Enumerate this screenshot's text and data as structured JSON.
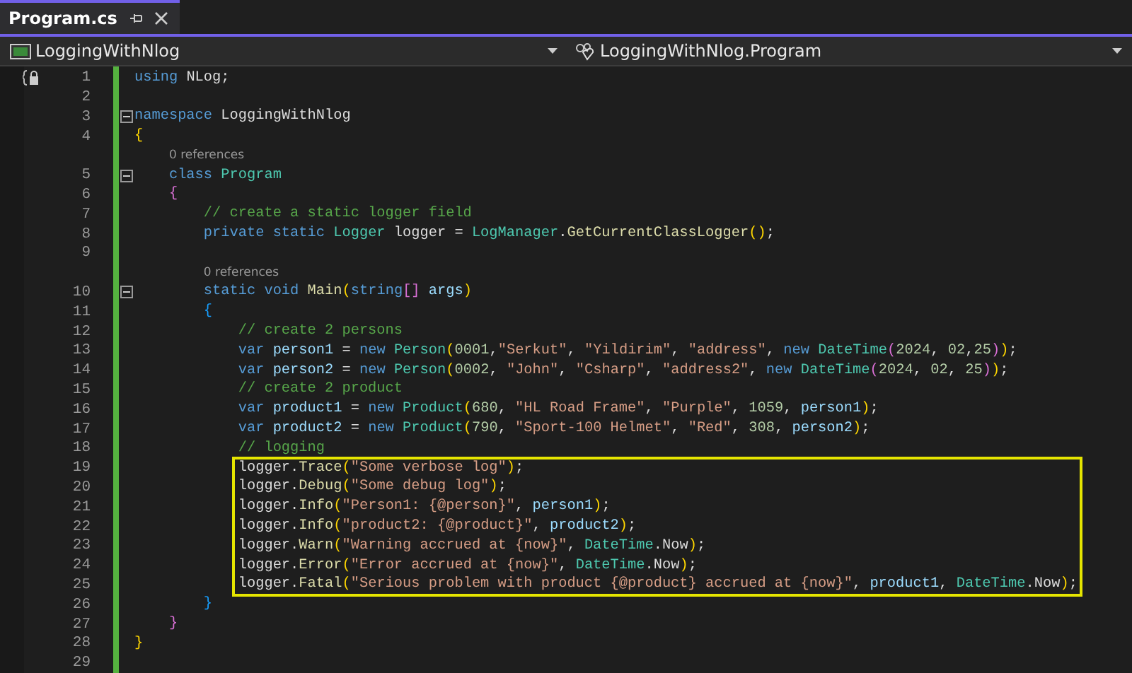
{
  "tab": {
    "title": "Program.cs",
    "selected": true
  },
  "nav": {
    "project": "LoggingWithNlog",
    "member": "LoggingWithNlog.Program"
  },
  "lines": [
    {
      "kind": "code",
      "number": "1",
      "highlighted": false,
      "tokens": [
        {
          "text": "using",
          "kind": "kw"
        },
        {
          "text": " NLog;",
          "kind": "txt"
        }
      ]
    },
    {
      "kind": "code",
      "number": "2",
      "highlighted": false
    },
    {
      "kind": "code",
      "number": "3",
      "highlighted": false,
      "fold": {
        "expanded": true
      },
      "tokens": [
        {
          "text": "namespace",
          "kind": "kw"
        },
        {
          "text": " LoggingWithNlog",
          "kind": "txt"
        }
      ]
    },
    {
      "kind": "code",
      "number": "4",
      "highlighted": false,
      "tokens": [
        {
          "text": "{",
          "kind": "open1"
        }
      ]
    },
    {
      "kind": "codelens",
      "text": "0 references"
    },
    {
      "kind": "code",
      "number": "5",
      "highlighted": false,
      "fold": {
        "expanded": true
      },
      "tokens": [
        {
          "text": "class ",
          "kind": "kw"
        },
        {
          "text": "Program",
          "kind": "type"
        }
      ]
    },
    {
      "kind": "code",
      "number": "6",
      "highlighted": false,
      "tokens": [
        {
          "text": "{",
          "kind": "open2"
        }
      ]
    },
    {
      "kind": "code",
      "number": "7",
      "highlighted": false,
      "tokens": [
        {
          "text": "// create a static logger field",
          "kind": "com"
        }
      ]
    },
    {
      "kind": "code",
      "number": "8",
      "highlighted": false,
      "tokens": [
        {
          "text": "private static ",
          "kind": "kw"
        },
        {
          "text": "Logger",
          "kind": "type"
        },
        {
          "text": " logger = ",
          "kind": "txt"
        },
        {
          "text": "LogManager",
          "kind": "type"
        },
        {
          "text": ".",
          "kind": "txt"
        },
        {
          "text": "GetCurrentClassLogger",
          "kind": "fn"
        },
        {
          "text": "()",
          "kind": "p1"
        },
        {
          "text": ";",
          "kind": "txt"
        }
      ]
    },
    {
      "kind": "code",
      "number": "9",
      "highlighted": false
    },
    {
      "kind": "codelens",
      "text": "0 references"
    },
    {
      "kind": "code",
      "number": "10",
      "highlighted": false,
      "fold": {
        "expanded": true
      },
      "tokens": [
        {
          "text": "static void ",
          "kind": "kw"
        },
        {
          "text": "Main",
          "kind": "fn"
        },
        {
          "text": "(",
          "kind": "p1"
        },
        {
          "text": "string",
          "kind": "kw"
        },
        {
          "text": "[]",
          "kind": "p2"
        },
        {
          "text": " args",
          "kind": "var"
        },
        {
          "text": ")",
          "kind": "p1"
        }
      ]
    },
    {
      "kind": "code",
      "number": "11",
      "highlighted": false,
      "tokens": [
        {
          "text": "{",
          "kind": "open3"
        }
      ]
    },
    {
      "kind": "code",
      "number": "12",
      "highlighted": false,
      "tokens": [
        {
          "text": "// create 2 persons",
          "kind": "com"
        }
      ]
    },
    {
      "kind": "code",
      "number": "13",
      "highlighted": false,
      "tokens": [
        {
          "text": "var",
          "kind": "kw"
        },
        {
          "text": " person1",
          "kind": "var"
        },
        {
          "text": " = ",
          "kind": "txt"
        },
        {
          "text": "new ",
          "kind": "kw"
        },
        {
          "text": "Person",
          "kind": "type"
        },
        {
          "text": "(",
          "kind": "p1"
        },
        {
          "text": "0001",
          "kind": "num"
        },
        {
          "text": ",",
          "kind": "txt"
        },
        {
          "text": "\"Serkut\"",
          "kind": "str"
        },
        {
          "text": ", ",
          "kind": "txt"
        },
        {
          "text": "\"Yildirim\"",
          "kind": "str"
        },
        {
          "text": ", ",
          "kind": "txt"
        },
        {
          "text": "\"address\"",
          "kind": "str"
        },
        {
          "text": ", ",
          "kind": "txt"
        },
        {
          "text": "new ",
          "kind": "kw"
        },
        {
          "text": "DateTime",
          "kind": "type"
        },
        {
          "text": "(",
          "kind": "p2"
        },
        {
          "text": "2024",
          "kind": "num"
        },
        {
          "text": ", ",
          "kind": "txt"
        },
        {
          "text": "02",
          "kind": "num"
        },
        {
          "text": ",",
          "kind": "txt"
        },
        {
          "text": "25",
          "kind": "num"
        },
        {
          "text": ")",
          "kind": "p2"
        },
        {
          "text": ")",
          "kind": "p1"
        },
        {
          "text": ";",
          "kind": "txt"
        }
      ]
    },
    {
      "kind": "code",
      "number": "14",
      "highlighted": false,
      "tokens": [
        {
          "text": "var",
          "kind": "kw"
        },
        {
          "text": " person2",
          "kind": "var"
        },
        {
          "text": " = ",
          "kind": "txt"
        },
        {
          "text": "new ",
          "kind": "kw"
        },
        {
          "text": "Person",
          "kind": "type"
        },
        {
          "text": "(",
          "kind": "p1"
        },
        {
          "text": "0002",
          "kind": "num"
        },
        {
          "text": ", ",
          "kind": "txt"
        },
        {
          "text": "\"John\"",
          "kind": "str"
        },
        {
          "text": ", ",
          "kind": "txt"
        },
        {
          "text": "\"Csharp\"",
          "kind": "str"
        },
        {
          "text": ", ",
          "kind": "txt"
        },
        {
          "text": "\"address2\"",
          "kind": "str"
        },
        {
          "text": ", ",
          "kind": "txt"
        },
        {
          "text": "new ",
          "kind": "kw"
        },
        {
          "text": "DateTime",
          "kind": "type"
        },
        {
          "text": "(",
          "kind": "p2"
        },
        {
          "text": "2024",
          "kind": "num"
        },
        {
          "text": ", ",
          "kind": "txt"
        },
        {
          "text": "02",
          "kind": "num"
        },
        {
          "text": ", ",
          "kind": "txt"
        },
        {
          "text": "25",
          "kind": "num"
        },
        {
          "text": ")",
          "kind": "p2"
        },
        {
          "text": ")",
          "kind": "p1"
        },
        {
          "text": ";",
          "kind": "txt"
        }
      ]
    },
    {
      "kind": "code",
      "number": "15",
      "highlighted": false,
      "tokens": [
        {
          "text": "// create 2 product",
          "kind": "com"
        }
      ]
    },
    {
      "kind": "code",
      "number": "16",
      "highlighted": false,
      "tokens": [
        {
          "text": "var",
          "kind": "kw"
        },
        {
          "text": " product1",
          "kind": "var"
        },
        {
          "text": " = ",
          "kind": "txt"
        },
        {
          "text": "new ",
          "kind": "kw"
        },
        {
          "text": "Product",
          "kind": "type"
        },
        {
          "text": "(",
          "kind": "p1"
        },
        {
          "text": "680",
          "kind": "num"
        },
        {
          "text": ", ",
          "kind": "txt"
        },
        {
          "text": "\"HL Road Frame\"",
          "kind": "str"
        },
        {
          "text": ", ",
          "kind": "txt"
        },
        {
          "text": "\"Purple\"",
          "kind": "str"
        },
        {
          "text": ", ",
          "kind": "txt"
        },
        {
          "text": "1059",
          "kind": "num"
        },
        {
          "text": ", ",
          "kind": "txt"
        },
        {
          "text": "person1",
          "kind": "var"
        },
        {
          "text": ")",
          "kind": "p1"
        },
        {
          "text": ";",
          "kind": "txt"
        }
      ]
    },
    {
      "kind": "code",
      "number": "17",
      "highlighted": false,
      "tokens": [
        {
          "text": "var",
          "kind": "kw"
        },
        {
          "text": " product2",
          "kind": "var"
        },
        {
          "text": " = ",
          "kind": "txt"
        },
        {
          "text": "new ",
          "kind": "kw"
        },
        {
          "text": "Product",
          "kind": "type"
        },
        {
          "text": "(",
          "kind": "p1"
        },
        {
          "text": "790",
          "kind": "num"
        },
        {
          "text": ", ",
          "kind": "txt"
        },
        {
          "text": "\"Sport-100 Helmet\"",
          "kind": "str"
        },
        {
          "text": ", ",
          "kind": "txt"
        },
        {
          "text": "\"Red\"",
          "kind": "str"
        },
        {
          "text": ", ",
          "kind": "txt"
        },
        {
          "text": "308",
          "kind": "num"
        },
        {
          "text": ", ",
          "kind": "txt"
        },
        {
          "text": "person2",
          "kind": "var"
        },
        {
          "text": ")",
          "kind": "p1"
        },
        {
          "text": ";",
          "kind": "txt"
        }
      ]
    },
    {
      "kind": "code",
      "number": "18",
      "highlighted": false,
      "tokens": [
        {
          "text": "// logging",
          "kind": "com"
        }
      ]
    },
    {
      "kind": "code",
      "number": "19",
      "highlighted": true,
      "tokens": [
        {
          "text": "logger.",
          "kind": "txt"
        },
        {
          "text": "Trace",
          "kind": "fn"
        },
        {
          "text": "(",
          "kind": "p1"
        },
        {
          "text": "\"Some verbose log\"",
          "kind": "str"
        },
        {
          "text": ")",
          "kind": "p1"
        },
        {
          "text": ";",
          "kind": "txt"
        }
      ]
    },
    {
      "kind": "code",
      "number": "20",
      "highlighted": true,
      "tokens": [
        {
          "text": "logger.",
          "kind": "txt"
        },
        {
          "text": "Debug",
          "kind": "fn"
        },
        {
          "text": "(",
          "kind": "p1"
        },
        {
          "text": "\"Some debug log\"",
          "kind": "str"
        },
        {
          "text": ")",
          "kind": "p1"
        },
        {
          "text": ";",
          "kind": "txt"
        }
      ]
    },
    {
      "kind": "code",
      "number": "21",
      "highlighted": true,
      "tokens": [
        {
          "text": "logger.",
          "kind": "txt"
        },
        {
          "text": "Info",
          "kind": "fn"
        },
        {
          "text": "(",
          "kind": "p1"
        },
        {
          "text": "\"Person1: {@person}\"",
          "kind": "str"
        },
        {
          "text": ", ",
          "kind": "txt"
        },
        {
          "text": "person1",
          "kind": "var"
        },
        {
          "text": ")",
          "kind": "p1"
        },
        {
          "text": ";",
          "kind": "txt"
        }
      ]
    },
    {
      "kind": "code",
      "number": "22",
      "highlighted": true,
      "tokens": [
        {
          "text": "logger.",
          "kind": "txt"
        },
        {
          "text": "Info",
          "kind": "fn"
        },
        {
          "text": "(",
          "kind": "p1"
        },
        {
          "text": "\"product2: {@product}\"",
          "kind": "str"
        },
        {
          "text": ", ",
          "kind": "txt"
        },
        {
          "text": "product2",
          "kind": "var"
        },
        {
          "text": ")",
          "kind": "p1"
        },
        {
          "text": ";",
          "kind": "txt"
        }
      ]
    },
    {
      "kind": "code",
      "number": "23",
      "highlighted": true,
      "tokens": [
        {
          "text": "logger.",
          "kind": "txt"
        },
        {
          "text": "Warn",
          "kind": "fn"
        },
        {
          "text": "(",
          "kind": "p1"
        },
        {
          "text": "\"Warning accrued at {now}\"",
          "kind": "str"
        },
        {
          "text": ", ",
          "kind": "txt"
        },
        {
          "text": "DateTime",
          "kind": "type"
        },
        {
          "text": ".Now",
          "kind": "txt"
        },
        {
          "text": ")",
          "kind": "p1"
        },
        {
          "text": ";",
          "kind": "txt"
        }
      ]
    },
    {
      "kind": "code",
      "number": "24",
      "highlighted": true,
      "tokens": [
        {
          "text": "logger.",
          "kind": "txt"
        },
        {
          "text": "Error",
          "kind": "fn"
        },
        {
          "text": "(",
          "kind": "p1"
        },
        {
          "text": "\"Error accrued at {now}\"",
          "kind": "str"
        },
        {
          "text": ", ",
          "kind": "txt"
        },
        {
          "text": "DateTime",
          "kind": "type"
        },
        {
          "text": ".Now",
          "kind": "txt"
        },
        {
          "text": ")",
          "kind": "p1"
        },
        {
          "text": ";",
          "kind": "txt"
        }
      ]
    },
    {
      "kind": "code",
      "number": "25",
      "highlighted": true,
      "tokens": [
        {
          "text": "logger.",
          "kind": "txt"
        },
        {
          "text": "Fatal",
          "kind": "fn"
        },
        {
          "text": "(",
          "kind": "p1"
        },
        {
          "text": "\"Serious problem with product {@product} accrued at {now}\"",
          "kind": "str"
        },
        {
          "text": ", ",
          "kind": "txt"
        },
        {
          "text": "product1",
          "kind": "var"
        },
        {
          "text": ", ",
          "kind": "txt"
        },
        {
          "text": "DateTime",
          "kind": "type"
        },
        {
          "text": ".Now",
          "kind": "txt"
        },
        {
          "text": ")",
          "kind": "p1"
        },
        {
          "text": ";",
          "kind": "txt"
        }
      ]
    },
    {
      "kind": "code",
      "number": "26",
      "highlighted": false,
      "tokens": [
        {
          "text": "}",
          "kind": "close3"
        }
      ]
    },
    {
      "kind": "code",
      "number": "27",
      "highlighted": false,
      "tokens": [
        {
          "text": "}",
          "kind": "close2"
        }
      ]
    },
    {
      "kind": "code",
      "number": "28",
      "highlighted": false,
      "tokens": [
        {
          "text": "}",
          "kind": "close1"
        }
      ]
    },
    {
      "kind": "code",
      "number": "29",
      "highlighted": false
    }
  ]
}
